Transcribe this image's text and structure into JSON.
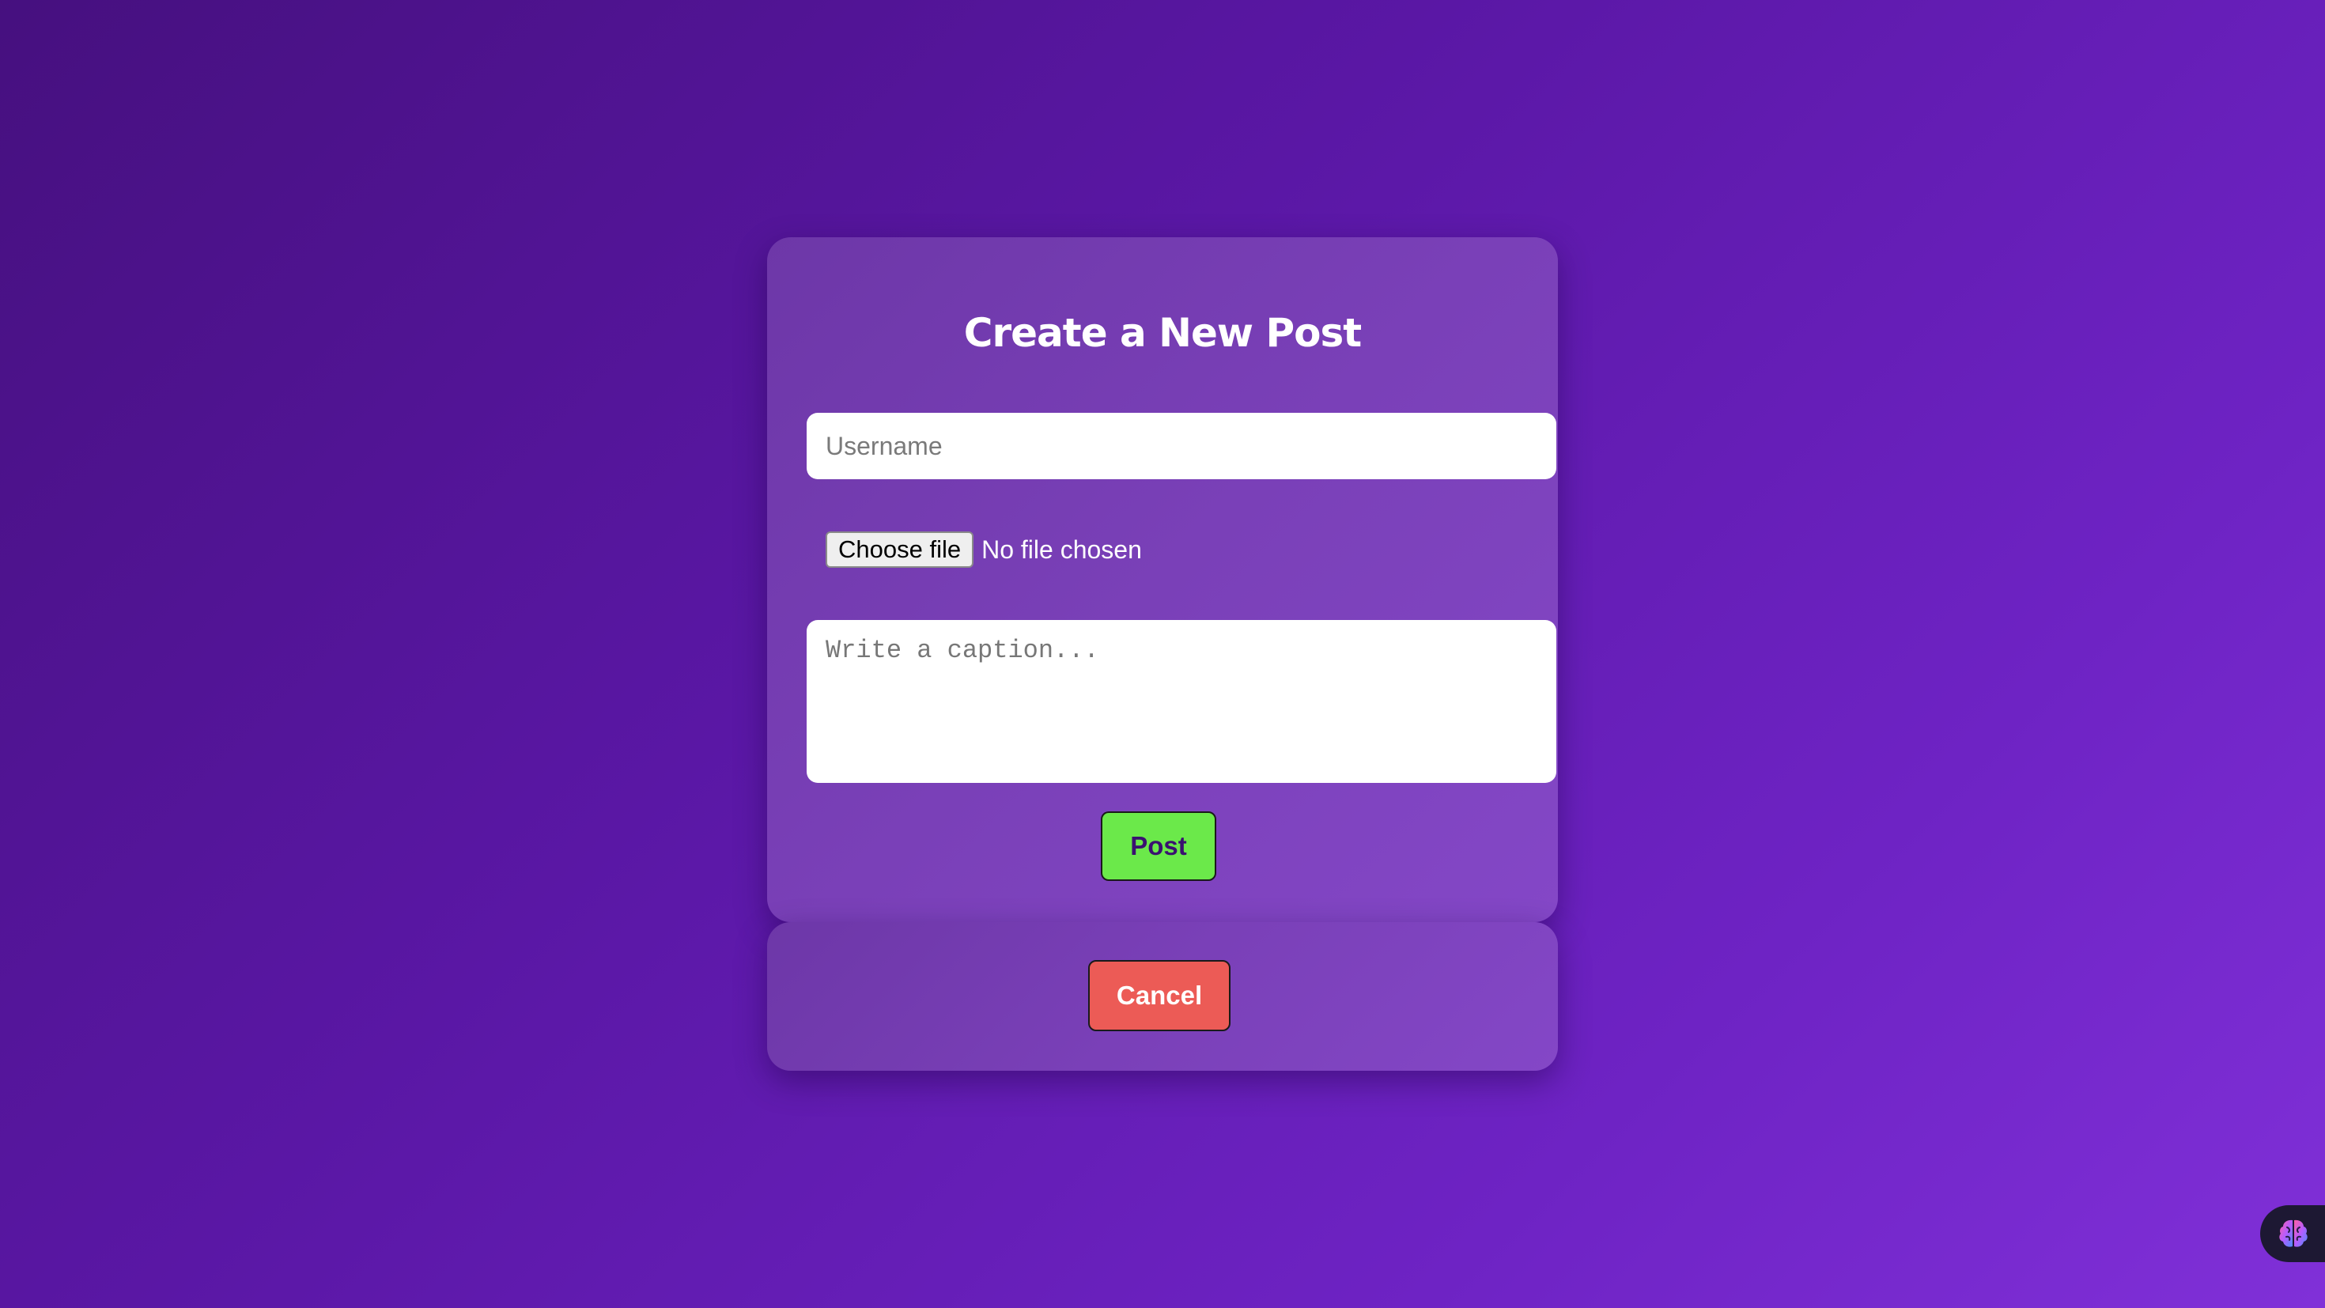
{
  "form": {
    "title": "Create a New Post",
    "username_placeholder": "Username",
    "file_button_label": "Choose file",
    "file_status": "No file chosen",
    "caption_placeholder": "Write a caption...",
    "post_label": "Post"
  },
  "cancel": {
    "label": "Cancel"
  },
  "extension": {
    "icon": "brain-icon"
  },
  "colors": {
    "post_button": "#6be94a",
    "cancel_button": "#ec5b56",
    "card": "#7a40b8",
    "background": "#5a17a5"
  }
}
